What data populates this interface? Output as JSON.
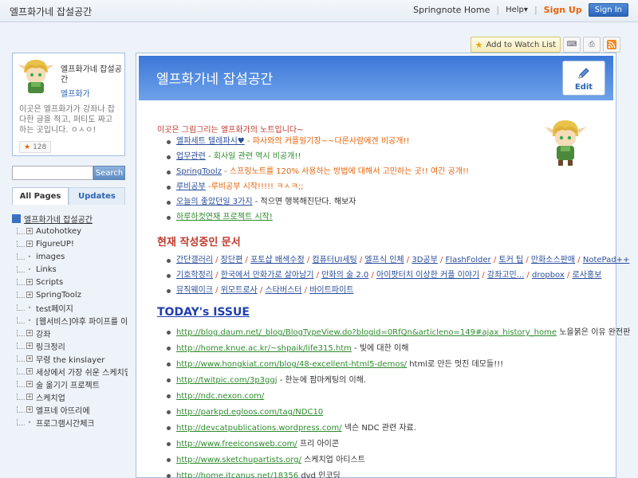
{
  "topbar": {
    "site_title": "엘프화가네 잡설공간",
    "home_link": "Springnote Home",
    "help": "Help",
    "signup": "Sign Up",
    "signin": "Sign In"
  },
  "toolbar": {
    "watch_label": "Add to Watch List",
    "icons": [
      "keyboard-icon",
      "print-icon",
      "rss-icon"
    ]
  },
  "profile": {
    "name": "엘프화가네 잡설공간",
    "user": "엘프화가",
    "description": "이곳은 엘프화가가 강좌나 잡다한 글을 적고, 퍼티도 짜고 하는 곳입니다. ㅇㅅㅇ!",
    "count": "128"
  },
  "search": {
    "button": "Search",
    "placeholder": ""
  },
  "tabs": {
    "all_pages": "All Pages",
    "updates": "Updates"
  },
  "tree": {
    "root": "엘프화가네 잡설공간",
    "items": [
      {
        "label": "Autohotkey",
        "expandable": true
      },
      {
        "label": "FigureUP!",
        "expandable": true
      },
      {
        "label": "images",
        "expandable": false
      },
      {
        "label": "Links",
        "expandable": false
      },
      {
        "label": "Scripts",
        "expandable": true
      },
      {
        "label": "SpringToolz",
        "expandable": true
      },
      {
        "label": "test페이지",
        "expandable": false
      },
      {
        "label": "[웹서비스]야후 파이프를 이",
        "expandable": false
      },
      {
        "label": "강좌",
        "expandable": true
      },
      {
        "label": "링크정리",
        "expandable": true
      },
      {
        "label": "무령 the kinslayer",
        "expandable": true
      },
      {
        "label": "세상에서 가장 쉬운 스케치업",
        "expandable": true
      },
      {
        "label": "술 옮기기 프로젝트",
        "expandable": true
      },
      {
        "label": "스케치업",
        "expandable": true
      },
      {
        "label": "엘프네 아뜨리에",
        "expandable": true
      },
      {
        "label": "프로그램시간체크",
        "expandable": false
      }
    ]
  },
  "main": {
    "title": "엘프화가네 잡설공간",
    "edit_label": "Edit",
    "intro": "이곳은 그림그리는 엘프화가의 노트입니다~",
    "notes": [
      {
        "link": "엘파세트 텔레파시♥",
        "text": " - 파사와의 커플일기장~~다른사람에겐 비공개!!",
        "cls": "t-orange"
      },
      {
        "link": "업무관련",
        "text": " - 회사일 관련 역시 비공개!!",
        "cls": "t-green"
      },
      {
        "link": "SpringToolz",
        "text": " - 스프링노트를 120% 사용하는 방법에 대해서 고민하는 곳!! 여긴 공개!!",
        "cls": "t-orange"
      },
      {
        "link": "루비공부",
        "text": " -루비공부 시작!!!!! ㅋㅅㅋ;;",
        "cls": "t-orange"
      },
      {
        "link": "오늘의 좋았던일 3가지",
        "text": " - 적으면 행복해진단다. 해보자",
        "cls": "t-dark"
      },
      {
        "link": "하루하컷연재 프로젝트 시작!",
        "text": "",
        "cls": "t-dark"
      }
    ],
    "current_heading": "현재 작성중인 문서",
    "docs": [
      [
        "간단갤러리",
        "장단편",
        "포토샵 배색수정",
        "컴퓨터UI세팅",
        "엘프식 인체",
        "3D공부",
        "FlashFolder",
        "토커 팁",
        "만화소스판매",
        "NotePad++"
      ],
      [
        "기호학정리",
        "한국에서 만화가로 살아남기",
        "만화의 술 2.0",
        "아이팟터치 이상한 커플 이야기",
        "강좌고민...",
        "dropbox",
        "로사홍보"
      ],
      [
        "뮤직웨이크",
        "위모트로사",
        "스타버스터",
        "바이트파이트"
      ]
    ],
    "today_heading": "TODAY's ISSUE",
    "issues": [
      {
        "url": "http://blog.daum.net/_blog/BlogTypeView.do?blogid=0RfQn&articleno=149#ajax_history_home",
        "text": "  노을붉은 이유 완전판"
      },
      {
        "url": "http://home.knue.ac.kr/~shpaik/life315.htm",
        "text": " - 빛에 대한 이해"
      },
      {
        "url": "http://www.hongkiat.com/blog/48-excellent-html5-demos/",
        "text": " html로 만든 멋진 데모들!!!"
      },
      {
        "url": "http://twitpic.com/3p3ggj",
        "text": "  - 한눈에 팜마케팅의 이해."
      },
      {
        "url": "http://ndc.nexon.com/",
        "text": ""
      },
      {
        "url": "http://parkpd.egloos.com/tag/NDC10",
        "text": ""
      },
      {
        "url": "http://devcatpublications.wordpress.com/",
        "text": "  넥슨 NDC 관련 자료."
      },
      {
        "url": "http://www.freeiconsweb.com/",
        "text": " 프리 아이콘"
      },
      {
        "url": "http://www.sketchupartists.org/",
        "text": "  스케치업 아티스트"
      },
      {
        "url": "http://home.itcanus.net/18356",
        "text": " dvd 인코딩"
      }
    ]
  }
}
